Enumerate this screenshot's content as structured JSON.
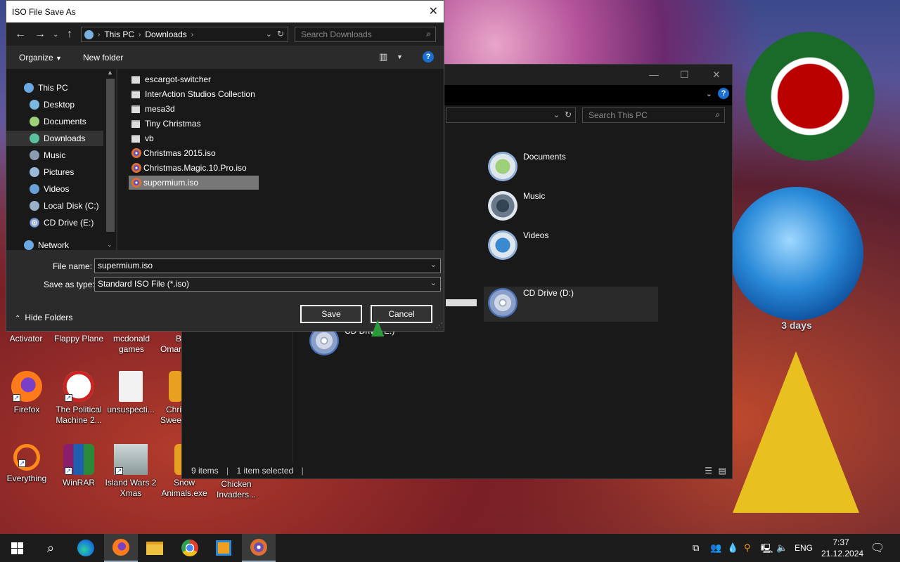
{
  "desktop": {
    "icons": [
      {
        "label": "Activator"
      },
      {
        "label": "Flappy Plane"
      },
      {
        "label": "mcdonald games"
      },
      {
        "label": "B Omar"
      },
      {
        "label": "Firefox"
      },
      {
        "label": "The Political Machine 2..."
      },
      {
        "label": "unsuspecti..."
      },
      {
        "label": "Chri Swee"
      },
      {
        "label": "Everything"
      },
      {
        "label": "WinRAR"
      },
      {
        "label": "Island Wars 2 Xmas"
      },
      {
        "label": "Snow Animals.exe"
      },
      {
        "label": "Chicken Invaders..."
      }
    ],
    "globe_text": "3 days"
  },
  "explorer": {
    "search_placeholder": "Search This PC",
    "items": [
      {
        "label": "Documents",
        "icon": "documents-folder-icon"
      },
      {
        "label": "Music",
        "icon": "music-folder-icon"
      },
      {
        "label": "Videos",
        "icon": "videos-folder-icon"
      },
      {
        "label": "CD Drive (D:)",
        "icon": "cd-drive-icon"
      },
      {
        "label": "CD Drive (E:)",
        "icon": "cd-drive-icon"
      }
    ],
    "status": {
      "count": "9 items",
      "selected": "1 item selected"
    }
  },
  "dialog": {
    "title": "ISO File Save As",
    "breadcrumb": [
      "This PC",
      "Downloads"
    ],
    "search_placeholder": "Search Downloads",
    "toolbar": {
      "organize": "Organize",
      "new_folder": "New folder"
    },
    "tree": [
      {
        "label": "This PC"
      },
      {
        "label": "Desktop"
      },
      {
        "label": "Documents"
      },
      {
        "label": "Downloads"
      },
      {
        "label": "Music"
      },
      {
        "label": "Pictures"
      },
      {
        "label": "Videos"
      },
      {
        "label": "Local Disk (C:)"
      },
      {
        "label": "CD Drive (E:)"
      },
      {
        "label": "Network"
      }
    ],
    "files": [
      {
        "name": "escargot-switcher",
        "type": "folder"
      },
      {
        "name": "InterAction Studios Collection",
        "type": "folder"
      },
      {
        "name": "mesa3d",
        "type": "folder"
      },
      {
        "name": "Tiny Christmas",
        "type": "folder"
      },
      {
        "name": "vb",
        "type": "folder"
      },
      {
        "name": "Christmas 2015.iso",
        "type": "iso"
      },
      {
        "name": "Christmas.Magic.10.Pro.iso",
        "type": "iso"
      },
      {
        "name": "supermium.iso",
        "type": "iso",
        "selected": true
      }
    ],
    "file_name_label": "File name:",
    "file_name_value": "supermium.iso",
    "save_type_label": "Save as type:",
    "save_type_value": "Standard ISO File (*.iso)",
    "hide_folders": "Hide Folders",
    "save_button": "Save",
    "cancel_button": "Cancel"
  },
  "taskbar": {
    "language": "ENG",
    "time": "7:37",
    "date": "21.12.2024"
  },
  "colors": {
    "accent": "#0078d7",
    "dark_bg": "#191919",
    "dialog_bg": "#2b2b2b"
  }
}
